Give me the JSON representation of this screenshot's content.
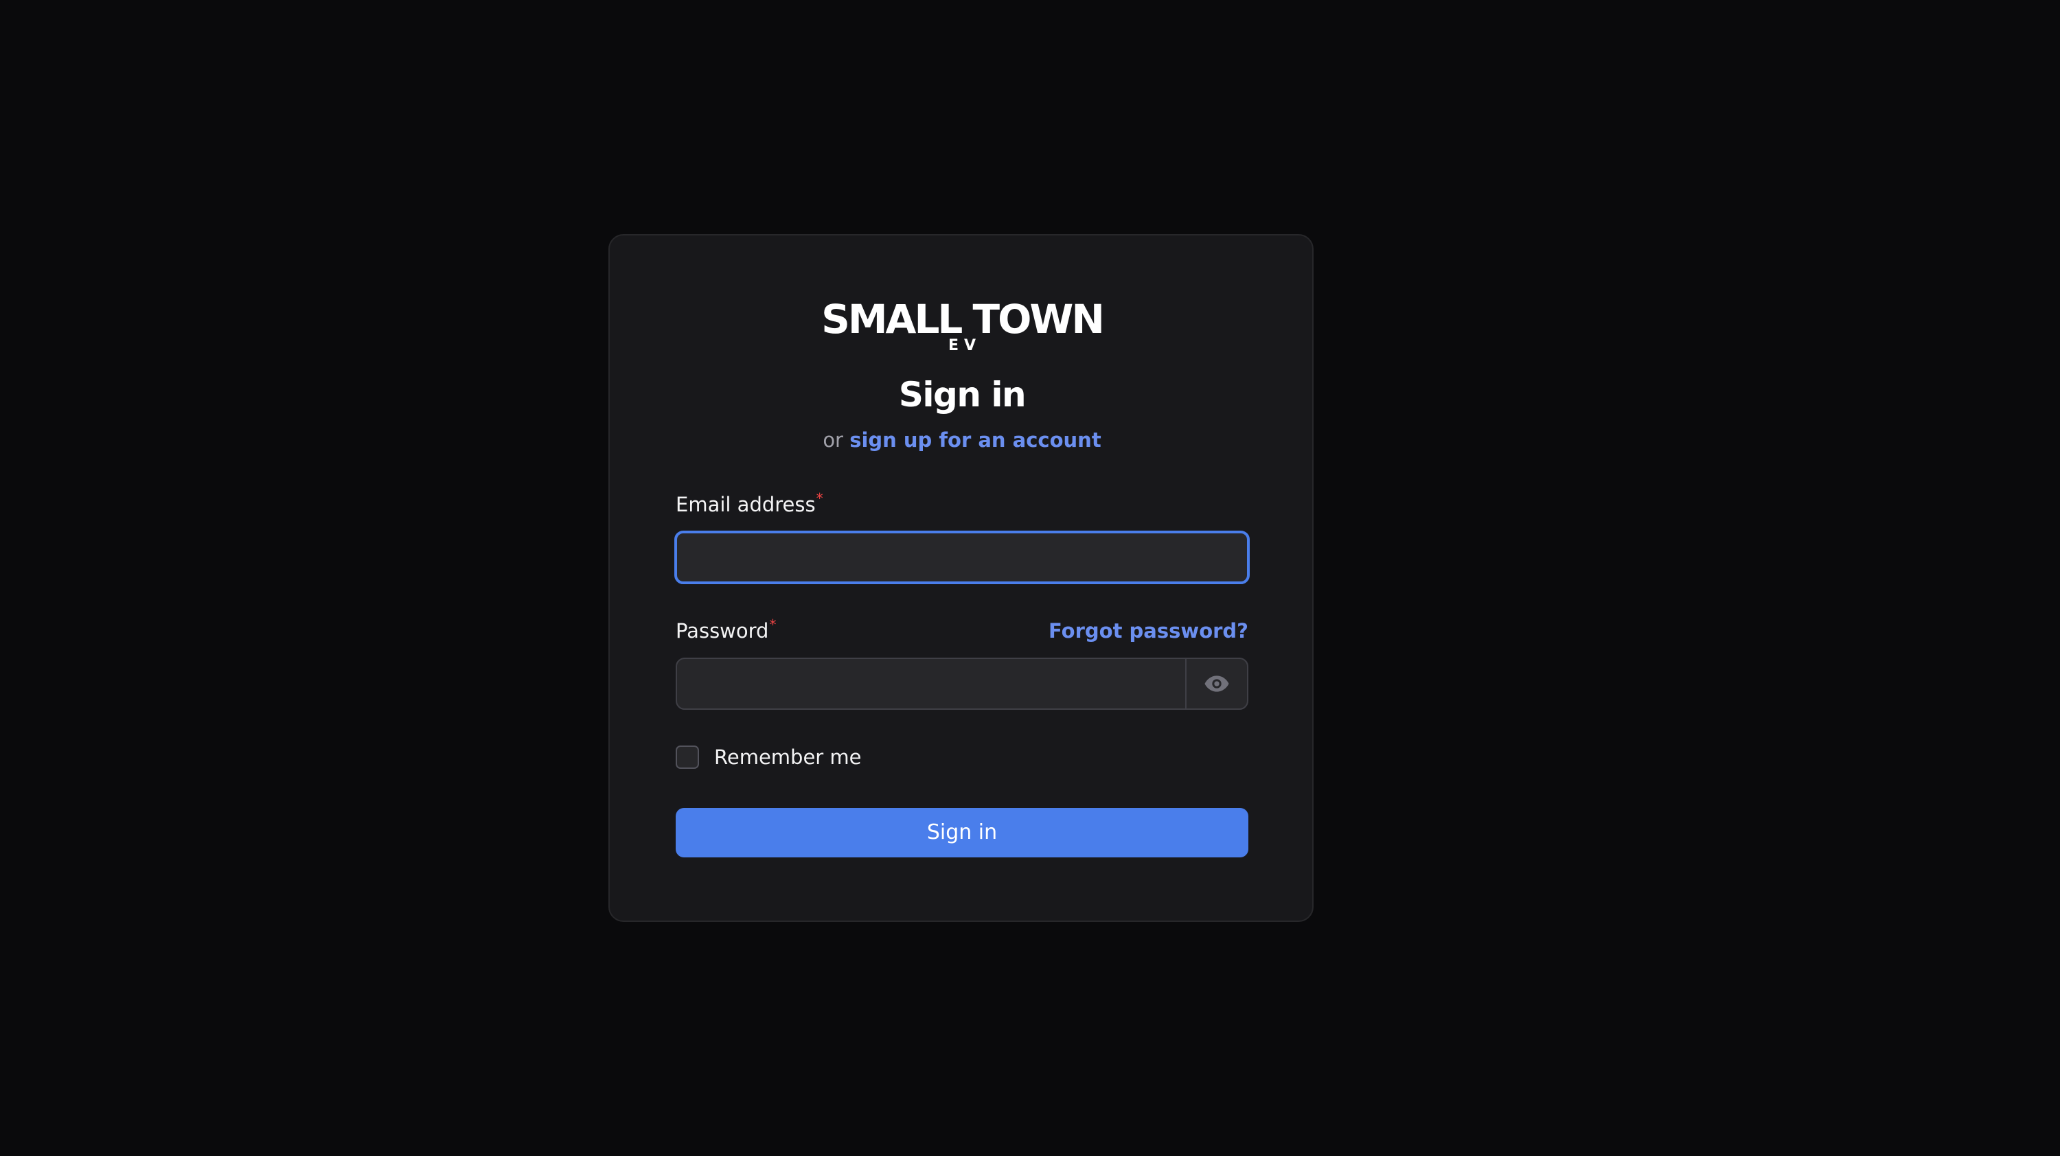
{
  "logo": {
    "main": "SMALL TOWN",
    "sub": "EV"
  },
  "heading": "Sign in",
  "subline": {
    "prefix": "or",
    "link": "sign up for an account"
  },
  "email": {
    "label": "Email address",
    "required_mark": "*",
    "value": "",
    "placeholder": ""
  },
  "password": {
    "label": "Password",
    "required_mark": "*",
    "value": "",
    "placeholder": "",
    "forgot_link": "Forgot password?",
    "toggle_icon": "eye-icon"
  },
  "remember": {
    "label": "Remember me",
    "checked": false
  },
  "submit_label": "Sign in",
  "colors": {
    "page_background": "#0a0a0c",
    "card_background": "#18181b",
    "accent": "#4a7eeb",
    "link": "#6b8ff0",
    "required": "#ef4444"
  }
}
